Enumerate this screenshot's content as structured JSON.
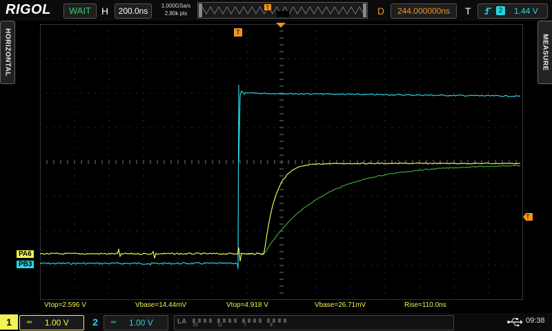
{
  "brand": "RIGOL",
  "top": {
    "run_state": "WAIT",
    "h_key": "H",
    "h_timebase": "200.0ns",
    "sample_rate": "1.000GSa/s",
    "memory_depth": "2.80k pts",
    "d_key": "D",
    "delay": "244.000000ns",
    "t_key": "T",
    "trig_channel": "2",
    "trig_level": "1.44 V",
    "trig_marker": "T"
  },
  "side": {
    "left_label": "HORIZONTAL",
    "right_label": "MEASURE"
  },
  "waveform_labels": {
    "ch1": "PA6",
    "ch2": "PB3",
    "trig_marker": "T"
  },
  "measurements": [
    {
      "text": "Vtop=2.596 V"
    },
    {
      "text": "Vbase=14.44mV"
    },
    {
      "text": "Vtop=4.918 V"
    },
    {
      "text": "Vbase=26.71mV"
    },
    {
      "text": "Rise=110.0ns"
    }
  ],
  "channels": [
    {
      "number": "1",
      "coupling": "═",
      "scale": "1.00 V",
      "color": "#f2f254"
    },
    {
      "number": "2",
      "coupling": "═",
      "scale": "1.00 V",
      "color": "#2ad4e4"
    }
  ],
  "la": {
    "label": "LA",
    "numbers": [
      "15",
      "11",
      "7",
      "3"
    ]
  },
  "status": {
    "usb_icon": "usb-icon",
    "clock": "09:38"
  },
  "colors": {
    "ch1": "#f2f254",
    "ch2": "#2ad4e4",
    "ch1_slow": "#3db53d",
    "trigger": "#f7941d",
    "grid": "#555555"
  }
}
